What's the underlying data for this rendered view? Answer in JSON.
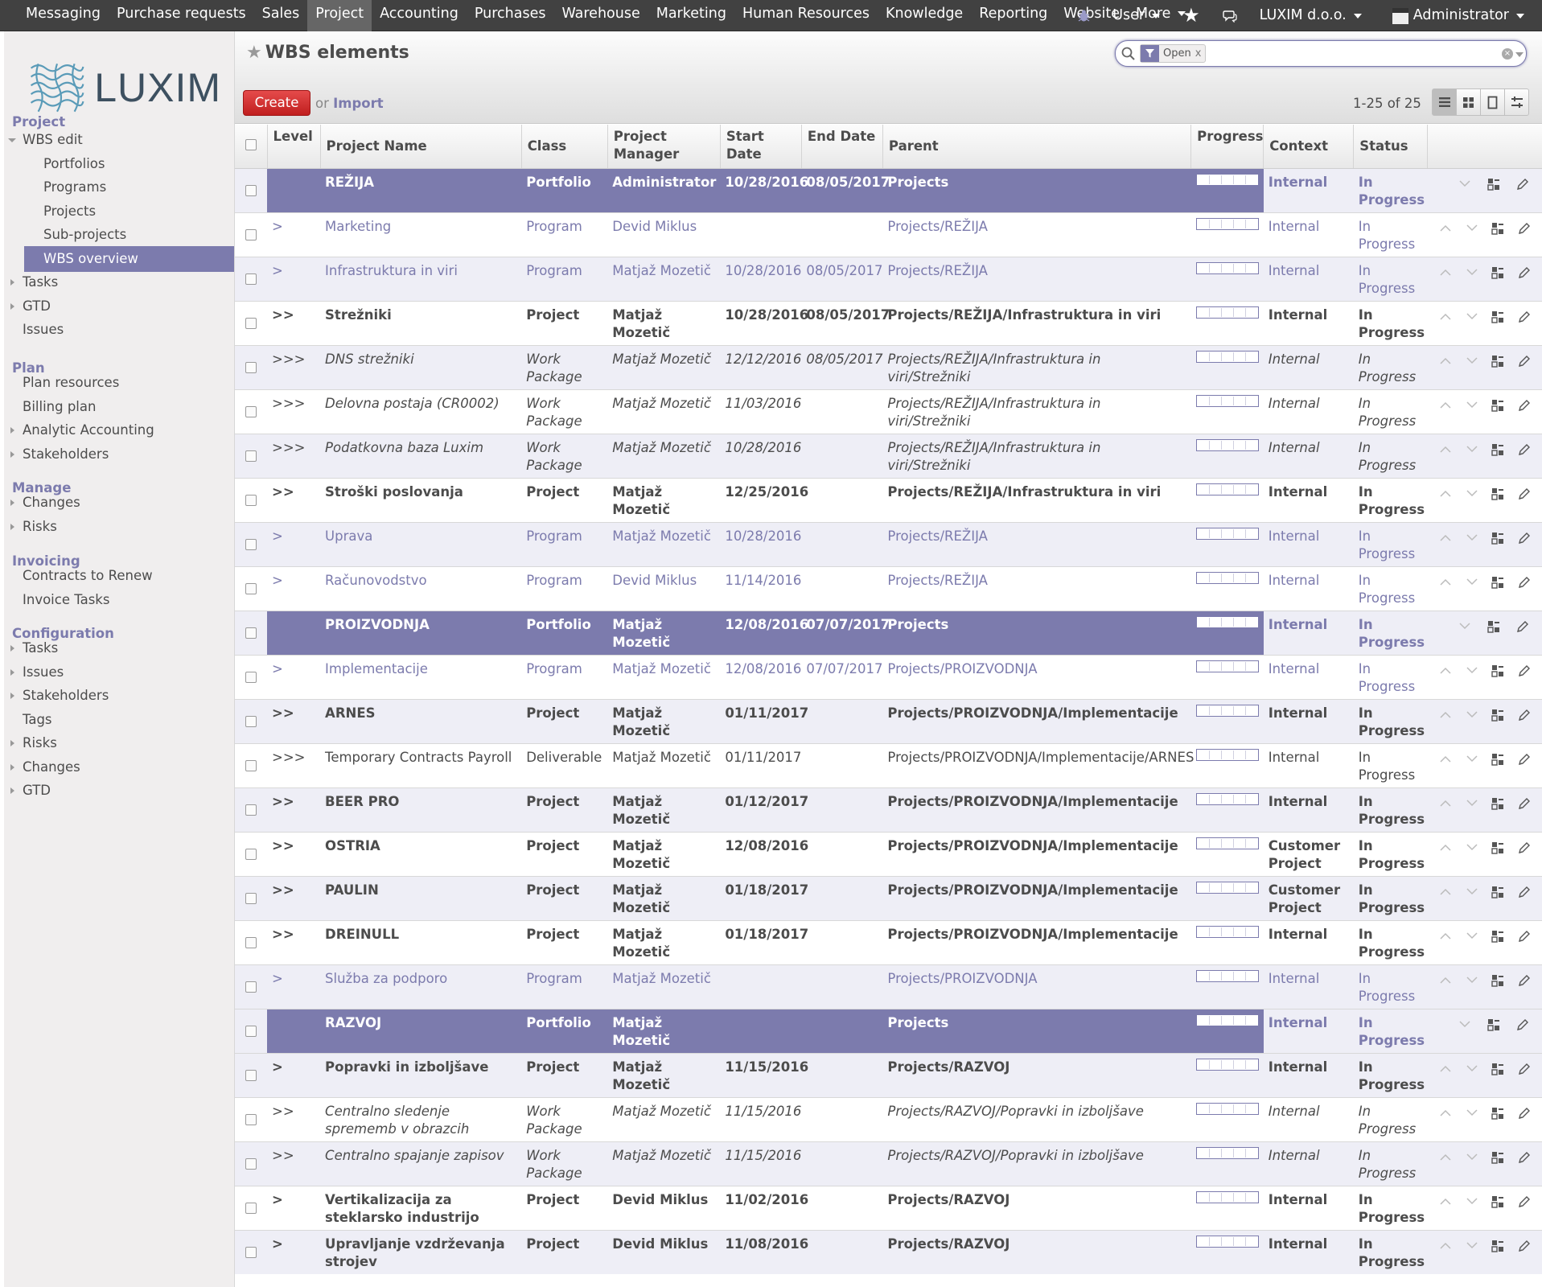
{
  "topbar": {
    "menu": [
      "Messaging",
      "Purchase requests",
      "Sales",
      "Project",
      "Accounting",
      "Purchases",
      "Warehouse",
      "Marketing",
      "Human Resources",
      "Knowledge",
      "Reporting",
      "Website",
      "More"
    ],
    "active": "Project",
    "user_menu": "User",
    "company": "LUXIM d.o.o.",
    "account": "Administrator"
  },
  "sidebar": {
    "logo_text": "LUXIM",
    "sections": [
      {
        "title": "Project",
        "items": [
          {
            "label": "WBS edit",
            "level": 1,
            "expander": "open"
          },
          {
            "label": "Portfolios",
            "level": 2
          },
          {
            "label": "Programs",
            "level": 2
          },
          {
            "label": "Projects",
            "level": 2
          },
          {
            "label": "Sub-projects",
            "level": 2
          },
          {
            "label": "WBS overview",
            "level": 2,
            "active": true
          },
          {
            "label": "Tasks",
            "level": 1,
            "expander": "closed"
          },
          {
            "label": "GTD",
            "level": 1,
            "expander": "closed"
          },
          {
            "label": "Issues",
            "level": 1
          }
        ]
      },
      {
        "title": "Plan",
        "items": [
          {
            "label": "Plan resources",
            "level": 1
          },
          {
            "label": "Billing plan",
            "level": 1
          },
          {
            "label": "Analytic Accounting",
            "level": 1,
            "expander": "closed"
          },
          {
            "label": "Stakeholders",
            "level": 1,
            "expander": "closed"
          }
        ]
      },
      {
        "title": "Manage",
        "items": [
          {
            "label": "Changes",
            "level": 1,
            "expander": "closed"
          },
          {
            "label": "Risks",
            "level": 1,
            "expander": "closed"
          }
        ]
      },
      {
        "title": "Invoicing",
        "items": [
          {
            "label": "Contracts to Renew",
            "level": 1
          },
          {
            "label": "Invoice Tasks",
            "level": 1
          }
        ]
      },
      {
        "title": "Configuration",
        "items": [
          {
            "label": "Tasks",
            "level": 1,
            "expander": "closed"
          },
          {
            "label": "Issues",
            "level": 1,
            "expander": "closed"
          },
          {
            "label": "Stakeholders",
            "level": 1,
            "expander": "closed"
          },
          {
            "label": "Tags",
            "level": 1
          },
          {
            "label": "Risks",
            "level": 1,
            "expander": "closed"
          },
          {
            "label": "Changes",
            "level": 1,
            "expander": "closed"
          },
          {
            "label": "GTD",
            "level": 1,
            "expander": "closed"
          }
        ]
      }
    ]
  },
  "control": {
    "title": "WBS elements",
    "search_facet": "Open",
    "search_value": "",
    "create_label": "Create",
    "or_label": "or",
    "import_label": "Import",
    "pager": "1-25 of 25"
  },
  "table": {
    "columns": [
      "Level",
      "Project Name",
      "Class",
      "Project Manager",
      "Start Date",
      "End Date",
      "Parent",
      "Progress",
      "Context",
      "Status"
    ],
    "rows": [
      {
        "level": "",
        "name": "REŽIJA",
        "cls": "Portfolio",
        "manager": "Administrator",
        "start": "10/28/2016",
        "end": "08/05/2017",
        "parent": "Projects",
        "progress": 0,
        "context": "Internal",
        "status": "In Progress"
      },
      {
        "level": ">",
        "name": "Marketing",
        "cls": "Program",
        "manager": "Devid Miklus",
        "start": "",
        "end": "",
        "parent": "Projects/REŽIJA",
        "progress": 0,
        "context": "Internal",
        "status": "In Progress"
      },
      {
        "level": ">",
        "name": "Infrastruktura in viri",
        "cls": "Program",
        "manager": "Matjaž Mozetič",
        "start": "10/28/2016",
        "end": "08/05/2017",
        "parent": "Projects/REŽIJA",
        "progress": 0,
        "context": "Internal",
        "status": "In Progress"
      },
      {
        "level": ">>",
        "name": "Strežniki",
        "cls": "Project",
        "manager": "Matjaž Mozetič",
        "start": "10/28/2016",
        "end": "08/05/2017",
        "parent": "Projects/REŽIJA/Infrastruktura in viri",
        "progress": 0,
        "context": "Internal",
        "status": "In Progress"
      },
      {
        "level": ">>>",
        "name": "DNS strežniki",
        "cls": "Work Package",
        "manager": "Matjaž Mozetič",
        "start": "12/12/2016",
        "end": "08/05/2017",
        "parent": "Projects/REŽIJA/Infrastruktura in viri/Strežniki",
        "progress": 0,
        "context": "Internal",
        "status": "In Progress"
      },
      {
        "level": ">>>",
        "name": "Delovna postaja (CR0002)",
        "cls": "Work Package",
        "manager": "Matjaž Mozetič",
        "start": "11/03/2016",
        "end": "",
        "parent": "Projects/REŽIJA/Infrastruktura in viri/Strežniki",
        "progress": 0,
        "context": "Internal",
        "status": "In Progress"
      },
      {
        "level": ">>>",
        "name": "Podatkovna baza Luxim",
        "cls": "Work Package",
        "manager": "Matjaž Mozetič",
        "start": "10/28/2016",
        "end": "",
        "parent": "Projects/REŽIJA/Infrastruktura in viri/Strežniki",
        "progress": 0,
        "context": "Internal",
        "status": "In Progress"
      },
      {
        "level": ">>",
        "name": "Stroški poslovanja",
        "cls": "Project",
        "manager": "Matjaž Mozetič",
        "start": "12/25/2016",
        "end": "",
        "parent": "Projects/REŽIJA/Infrastruktura in viri",
        "progress": 0,
        "context": "Internal",
        "status": "In Progress"
      },
      {
        "level": ">",
        "name": "Uprava",
        "cls": "Program",
        "manager": "Matjaž Mozetič",
        "start": "10/28/2016",
        "end": "",
        "parent": "Projects/REŽIJA",
        "progress": 0,
        "context": "Internal",
        "status": "In Progress"
      },
      {
        "level": ">",
        "name": "Računovodstvo",
        "cls": "Program",
        "manager": "Devid Miklus",
        "start": "11/14/2016",
        "end": "",
        "parent": "Projects/REŽIJA",
        "progress": 0,
        "context": "Internal",
        "status": "In Progress"
      },
      {
        "level": "",
        "name": "PROIZVODNJA",
        "cls": "Portfolio",
        "manager": "Matjaž Mozetič",
        "start": "12/08/2016",
        "end": "07/07/2017",
        "parent": "Projects",
        "progress": 0,
        "context": "Internal",
        "status": "In Progress"
      },
      {
        "level": ">",
        "name": "Implementacije",
        "cls": "Program",
        "manager": "Matjaž Mozetič",
        "start": "12/08/2016",
        "end": "07/07/2017",
        "parent": "Projects/PROIZVODNJA",
        "progress": 0,
        "context": "Internal",
        "status": "In Progress"
      },
      {
        "level": ">>",
        "name": "ARNES",
        "cls": "Project",
        "manager": "Matjaž Mozetič",
        "start": "01/11/2017",
        "end": "",
        "parent": "Projects/PROIZVODNJA/Implementacije",
        "progress": 0,
        "context": "Internal",
        "status": "In Progress"
      },
      {
        "level": ">>>",
        "name": "Temporary Contracts Payroll",
        "cls": "Deliverable",
        "manager": "Matjaž Mozetič",
        "start": "01/11/2017",
        "end": "",
        "parent": "Projects/PROIZVODNJA/Implementacije/ARNES",
        "progress": 0,
        "context": "Internal",
        "status": "In Progress"
      },
      {
        "level": ">>",
        "name": "BEER PRO",
        "cls": "Project",
        "manager": "Matjaž Mozetič",
        "start": "01/12/2017",
        "end": "",
        "parent": "Projects/PROIZVODNJA/Implementacije",
        "progress": 0,
        "context": "Internal",
        "status": "In Progress"
      },
      {
        "level": ">>",
        "name": "OSTRIA",
        "cls": "Project",
        "manager": "Matjaž Mozetič",
        "start": "12/08/2016",
        "end": "",
        "parent": "Projects/PROIZVODNJA/Implementacije",
        "progress": 0,
        "context": "Customer Project",
        "status": "In Progress"
      },
      {
        "level": ">>",
        "name": "PAULIN",
        "cls": "Project",
        "manager": "Matjaž Mozetič",
        "start": "01/18/2017",
        "end": "",
        "parent": "Projects/PROIZVODNJA/Implementacije",
        "progress": 0,
        "context": "Customer Project",
        "status": "In Progress"
      },
      {
        "level": ">>",
        "name": "DREINULL",
        "cls": "Project",
        "manager": "Matjaž Mozetič",
        "start": "01/18/2017",
        "end": "",
        "parent": "Projects/PROIZVODNJA/Implementacije",
        "progress": 0,
        "context": "Internal",
        "status": "In Progress"
      },
      {
        "level": ">",
        "name": "Služba za podporo",
        "cls": "Program",
        "manager": "Matjaž Mozetič",
        "start": "",
        "end": "",
        "parent": "Projects/PROIZVODNJA",
        "progress": 0,
        "context": "Internal",
        "status": "In Progress"
      },
      {
        "level": "",
        "name": "RAZVOJ",
        "cls": "Portfolio",
        "manager": "Matjaž Mozetič",
        "start": "",
        "end": "",
        "parent": "Projects",
        "progress": 0,
        "context": "Internal",
        "status": "In Progress"
      },
      {
        "level": ">",
        "name": "Popravki in izboljšave",
        "cls": "Project",
        "manager": "Matjaž Mozetič",
        "start": "11/15/2016",
        "end": "",
        "parent": "Projects/RAZVOJ",
        "progress": 0,
        "context": "Internal",
        "status": "In Progress"
      },
      {
        "level": ">>",
        "name": "Centralno sledenje sprememb v obrazcih",
        "cls": "Work Package",
        "manager": "Matjaž Mozetič",
        "start": "11/15/2016",
        "end": "",
        "parent": "Projects/RAZVOJ/Popravki in izboljšave",
        "progress": 0,
        "context": "Internal",
        "status": "In Progress"
      },
      {
        "level": ">>",
        "name": "Centralno spajanje zapisov",
        "cls": "Work Package",
        "manager": "Matjaž Mozetič",
        "start": "11/15/2016",
        "end": "",
        "parent": "Projects/RAZVOJ/Popravki in izboljšave",
        "progress": 0,
        "context": "Internal",
        "status": "In Progress"
      },
      {
        "level": ">",
        "name": "Vertikalizacija za steklarsko industrijo",
        "cls": "Project",
        "manager": "Devid Miklus",
        "start": "11/02/2016",
        "end": "",
        "parent": "Projects/RAZVOJ",
        "progress": 0,
        "context": "Internal",
        "status": "In Progress"
      },
      {
        "level": ">",
        "name": "Upravljanje vzdrževanja strojev",
        "cls": "Project",
        "manager": "Devid Miklus",
        "start": "11/08/2016",
        "end": "",
        "parent": "Projects/RAZVOJ",
        "progress": 0,
        "context": "Internal",
        "status": "In Progress"
      }
    ]
  },
  "colors": {
    "accent": "#7c7bad",
    "topbar": "#414141",
    "create": "#d13333"
  },
  "icons": [
    "bug-icon",
    "star-icon",
    "chat-icon",
    "search-icon",
    "filter-icon",
    "list-view-icon",
    "kanban-view-icon",
    "form-view-icon",
    "gantt-view-icon",
    "move-up-icon",
    "move-down-icon",
    "children-icon",
    "edit-icon"
  ]
}
